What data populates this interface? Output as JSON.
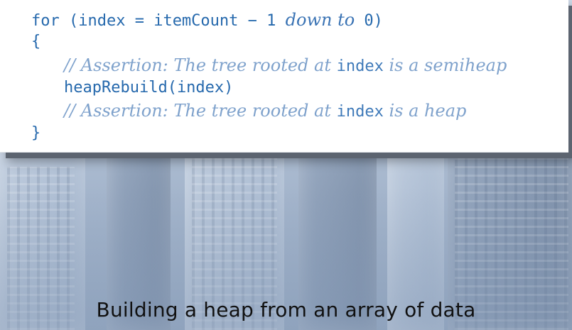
{
  "code": {
    "line1": {
      "keyword_for": "for",
      "init": " (index = itemCount − 1 ",
      "down_to": "down to",
      "end": " 0)"
    },
    "line2": {
      "text": "{"
    },
    "line3": {
      "slashes": "//",
      "comment_a": " Assertion: The tree rooted at ",
      "code_word": "index",
      "comment_b": " is a semiheap"
    },
    "line4": {
      "text": "heapRebuild(index)"
    },
    "line5": {
      "slashes": "//",
      "comment_a": " Assertion: The tree rooted at ",
      "code_word": "index",
      "comment_b": " is a heap"
    },
    "line6": {
      "text": "}"
    }
  },
  "caption": "Building a heap from an array of data"
}
